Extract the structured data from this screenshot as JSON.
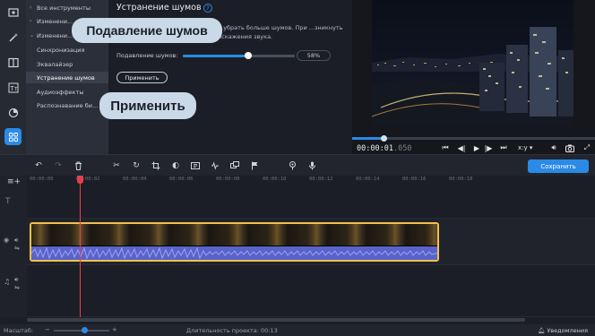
{
  "tools": {
    "all_tools": "Все инструменты",
    "section_video": "Изменени...",
    "section_audio": "Изменени...",
    "items": [
      "Синхронизация",
      "Эквалайзер",
      "Устранение шумов",
      "Аудиоэффекты",
      "Распознавание би..."
    ]
  },
  "settings": {
    "title": "Устранение шумов",
    "help": "?",
    "description": "...убрать больше шумов. При ...зникнуть искажения звука.",
    "slider_label": "Подавление шумов:",
    "slider_value_text": "58%",
    "slider_value": 0.58,
    "apply_label": "Применить"
  },
  "tooltips": {
    "noise": "Подавление шумов",
    "apply": "Применить"
  },
  "preview": {
    "timecode_main": "00:00:01",
    "timecode_ms": ".050",
    "progress": 0.13,
    "aspect": "x:y"
  },
  "toolbar": {
    "export_label": "Сохранить"
  },
  "ruler": {
    "ticks": [
      "00:00:00",
      "00:00:02",
      "00:00:04",
      "00:00:06",
      "00:00:08",
      "00:00:10",
      "00:00:12",
      "00:00:14",
      "00:00:16",
      "00:00:18"
    ]
  },
  "status": {
    "zoom_label": "Масштаб:",
    "zoom_value": 0.55,
    "duration": "Длительность проекта: 00:13",
    "notifications": "Уведомления"
  },
  "colors": {
    "accent": "#2a8ae6",
    "playhead": "#e6404a",
    "clip_border": "#f2c14e"
  }
}
